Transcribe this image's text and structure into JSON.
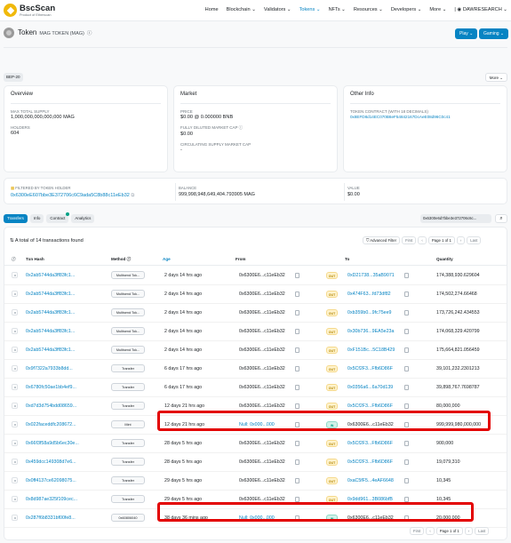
{
  "brand": {
    "name": "BscScan",
    "tagline": "Product of Etherscan"
  },
  "nav": [
    "Home",
    "Blockchain ⌄",
    "Validators ⌄",
    "Tokens ⌄",
    "NFTs ⌄",
    "Resources ⌄",
    "Developers ⌄",
    "More ⌄",
    "| ◉ DAWRESEARCH ⌄"
  ],
  "token": {
    "label": "Token",
    "name": "MAG TOKEN (MAG)",
    "play_button": "Play ⌄",
    "gaming_button": "Gaming ⌄",
    "standard_badge": "BEP-20",
    "more_button": "More ⌄"
  },
  "overview": {
    "title": "Overview",
    "max_supply_label": "MAX TOTAL SUPPLY",
    "max_supply_value": "1,000,000,000,000,000 MAG",
    "holders_label": "HOLDERS",
    "holders_value": "604"
  },
  "market": {
    "title": "Market",
    "price_label": "PRICE",
    "price_value": "$0.00 @ 0.000000 BNB",
    "fdmc_label": "FULLY DILUTED MARKET CAP ⓘ",
    "fdmc_value": "$0.00",
    "circ_label": "CIRCULATING SUPPLY MARKET CAP",
    "circ_value": "-"
  },
  "other_info": {
    "title": "Other Info",
    "contract_label": "TOKEN CONTRACT (WITH 18 DECIMALS)",
    "contract_value": "0x8EFD8d14EC070B6eF54842167DcAeE08d96C0c41"
  },
  "filter": {
    "label": "FILTERED BY TOKEN HOLDER",
    "holder": "0x6300eE607bbe3E372706c6C9ada5C8b88c11eEb32",
    "balance_label": "BALANCE",
    "balance_value": "999,998,948,649,404.793905 MAG",
    "value_label": "VALUE",
    "value_value": "$0.00"
  },
  "tabs": [
    "Transfers",
    "Info",
    "Contract",
    "Analytics"
  ],
  "search_value": "0x6300e6d7bbe3e372706c6c...",
  "table": {
    "summary": "⇅ A total of 14 transactions found",
    "advanced_filter": "Advanced Filter",
    "pager": {
      "first": "First",
      "prev": "‹",
      "page": "Page 1 of 1",
      "next": "›",
      "last": "Last"
    },
    "headers": {
      "hash": "Txn Hash",
      "method": "Method ⓘ",
      "age": "Age",
      "from": "From",
      "to": "To",
      "quantity": "Quantity"
    },
    "rows": [
      {
        "hash": "0x2ab5744da3ff83fc1...",
        "method": "Multisend Tok...",
        "age": "2 days 14 hrs ago",
        "from": "0x6300E6...c11eEb32",
        "dir": "OUT",
        "to": "0xD21738...35aB9071",
        "qty": "174,388,930.629604"
      },
      {
        "hash": "0x2ab5744da3ff83fc1...",
        "method": "Multisend Tok...",
        "age": "2 days 14 hrs ago",
        "from": "0x6300E6...c11eEb32",
        "dir": "OUT",
        "to": "0x474F63...fd73df82",
        "qty": "174,502,274.66468"
      },
      {
        "hash": "0x2ab5744da3ff83fc1...",
        "method": "Multisend Tok...",
        "age": "2 days 14 hrs ago",
        "from": "0x6300E6...c11eEb32",
        "dir": "OUT",
        "to": "0xb359b0...9fc75ee9",
        "qty": "173,726,242.434553"
      },
      {
        "hash": "0x2ab5744da3ff83fc1...",
        "method": "Multisend Tok...",
        "age": "2 days 14 hrs ago",
        "from": "0x6300E6...c11eEb32",
        "dir": "OUT",
        "to": "0x30b736...9EA5e23a",
        "qty": "174,068,329.420799"
      },
      {
        "hash": "0x2ab5744da3ff83fc1...",
        "method": "Multisend Tok...",
        "age": "2 days 14 hrs ago",
        "from": "0x6300E6...c11eEb32",
        "dir": "OUT",
        "to": "0xF151Bc...5C18B429",
        "qty": "175,664,821.056459"
      },
      {
        "hash": "0x9f7322a7933b8dd...",
        "method": "Transfer",
        "age": "6 days 17 hrs ago",
        "from": "0x6300E6...c11eEb32",
        "dir": "OUT",
        "to": "0x5Cf2F3...Ffb6D86F",
        "qty": "39,101,232.2301213"
      },
      {
        "hash": "0x6780fc50ae1bb4ef9...",
        "method": "Transfer",
        "age": "6 days 17 hrs ago",
        "from": "0x6300E6...c11eEb32",
        "dir": "OUT",
        "to": "0x0356a6...6a70d139",
        "qty": "39,898,767.7698787"
      },
      {
        "hash": "0xd7d3d754bdd08659...",
        "method": "Transfer",
        "age": "12 days 21 hrs ago",
        "from": "0x6300E6...c11eEb32",
        "dir": "OUT",
        "to": "0x5Cf2F3...Ffb6D86F",
        "qty": "80,000,000"
      },
      {
        "hash": "0x022faceddfc208672...",
        "method": "Mint",
        "age": "12 days 21 hrs ago",
        "from": "Null: 0x000...000",
        "dir": "IN",
        "to": "0x6300E6...c11eEb32",
        "qty": "999,999,980,000,000"
      },
      {
        "hash": "0x66f3f58a9d5b6ec30e...",
        "method": "Transfer",
        "age": "28 days 5 hrs ago",
        "from": "0x6300E6...c11eEb32",
        "dir": "OUT",
        "to": "0x5Cf2F3...Ffb6D86F",
        "qty": "900,000"
      },
      {
        "hash": "0x459dcc149308d7e6...",
        "method": "Transfer",
        "age": "28 days 5 hrs ago",
        "from": "0x6300E6...c11eEb32",
        "dir": "OUT",
        "to": "0x5Cf2F3...Ffb6D86F",
        "qty": "19,079,310"
      },
      {
        "hash": "0x0ff4137ce62098075...",
        "method": "Transfer",
        "age": "29 days 5 hrs ago",
        "from": "0x6300E6...c11eEb32",
        "dir": "OUT",
        "to": "0xaC5fF5...4eAF6648",
        "qty": "10,345"
      },
      {
        "hash": "0x8d987ae325f109cec...",
        "method": "Transfer",
        "age": "29 days 5 hrs ago",
        "from": "0x6300E6...c11eEb32",
        "dir": "OUT",
        "to": "0x9dd961...3B086bfB",
        "qty": "10,345"
      },
      {
        "hash": "0x287f6b8331bf00fe8...",
        "method": "0x60806040",
        "age": "38 days 36 mins ago",
        "from": "Null: 0x000...000",
        "dir": "IN",
        "to": "0x6300E6...c11eEb32",
        "qty": "20,000,000"
      }
    ]
  }
}
